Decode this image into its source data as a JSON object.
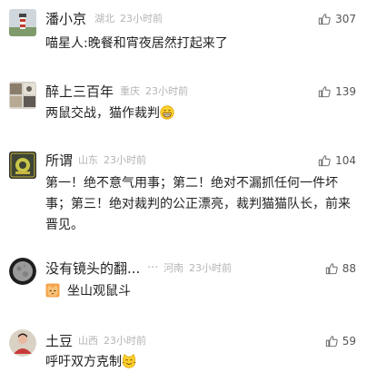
{
  "comments": [
    {
      "name": "潘小京",
      "location": "湖北",
      "time": "23小时前",
      "likes": "307",
      "text": "喵星人:晚餐和宵夜居然打起来了"
    },
    {
      "name": "醉上三百年",
      "location": "重庆",
      "time": "23小时前",
      "likes": "139",
      "text": "两鼠交战，猫作裁判",
      "emoji": "grin-emoji"
    },
    {
      "name": "所谓",
      "location": "山东",
      "time": "23小时前",
      "likes": "104",
      "text": "第一！绝不意气用事；第二！绝对不漏抓任何一件坏事；第三！绝对裁判的公正漂亮，裁判猫猫队长，前来晋见。"
    },
    {
      "name": "没有镜头的翻...",
      "location": "河南",
      "time": "23小时前",
      "likes": "88",
      "text": "坐山观鼠斗",
      "emoji": "cat-emoji"
    },
    {
      "name": "土豆",
      "location": "山西",
      "time": "23小时前",
      "likes": "59",
      "text": "呼吁双方克制",
      "emoji": "cat-face-emoji"
    }
  ],
  "icons": {
    "like": "thumbs-up-icon",
    "more": "more-dots-icon"
  },
  "colors": {
    "meta_gray": "#b4b4b4",
    "text_dark": "#222222"
  }
}
